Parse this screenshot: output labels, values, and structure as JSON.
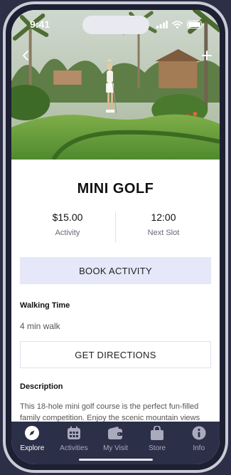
{
  "status_bar": {
    "time": "9:41",
    "icons": [
      "signal-icon",
      "wifi-icon",
      "battery-icon"
    ]
  },
  "hero": {
    "image": "mini-golf-photo"
  },
  "activity": {
    "title": "MINI GOLF",
    "price": "$15.00",
    "price_label": "Activity",
    "next_slot": "12:00",
    "next_slot_label": "Next Slot",
    "book_label": "BOOK ACTIVITY",
    "walking_time_title": "Walking Time",
    "walking_time": "4 min walk",
    "directions_label": "GET DIRECTIONS",
    "description_title": "Description",
    "description": "This 18-hole mini golf course is the perfect fun-filled family competition. Enjoy the scenic mountain views"
  },
  "tab_bar": {
    "tabs": [
      {
        "label": "Explore",
        "icon": "compass-icon",
        "active": true
      },
      {
        "label": "Activities",
        "icon": "calendar-icon",
        "active": false
      },
      {
        "label": "My Visit",
        "icon": "wallet-icon",
        "active": false
      },
      {
        "label": "Store",
        "icon": "shopping-bag-icon",
        "active": false
      },
      {
        "label": "Info",
        "icon": "info-icon",
        "active": false
      }
    ]
  },
  "colors": {
    "accent_button": "#e6e7f8",
    "tab_bar": "#2c2f48",
    "background": "#2c2f45"
  }
}
